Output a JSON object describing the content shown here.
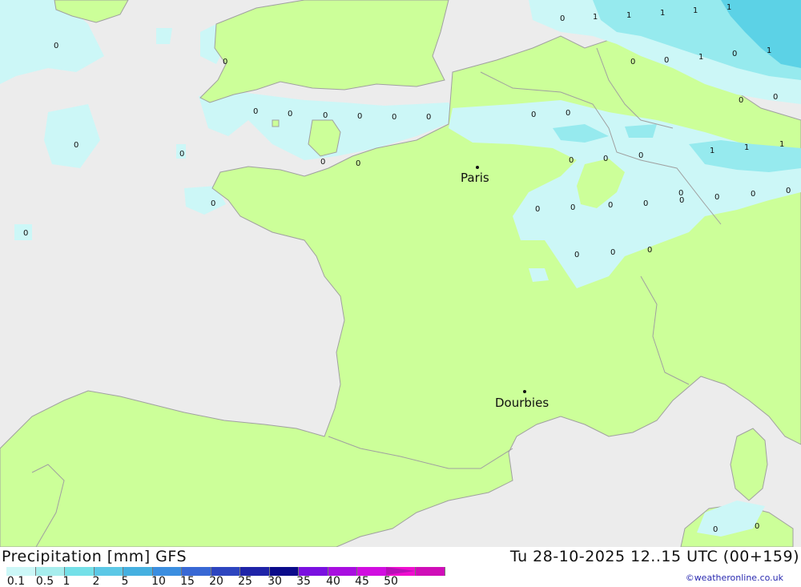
{
  "map": {
    "cities": [
      {
        "name": "Paris"
      },
      {
        "name": "Dourbies"
      }
    ],
    "contour_labels": [
      "0",
      "1",
      "1",
      "1",
      "1",
      "1",
      "0",
      "0",
      "1",
      "0",
      "1",
      "1",
      "0",
      "0",
      "0",
      "0",
      "0",
      "0",
      "0",
      "0",
      "0",
      "0",
      "0",
      "0",
      "0",
      "0",
      "0",
      "0",
      "0",
      "0",
      "0",
      "1",
      "1",
      "1",
      "0",
      "0",
      "0",
      "0",
      "0",
      "0",
      "0",
      "0",
      "0",
      "0",
      "0",
      "0",
      "0",
      "0",
      "0",
      "0",
      "0"
    ],
    "colors": {
      "sea": "#ececec",
      "land": "#ccff99",
      "precip_light": "#ccf7f7",
      "precip_mid": "#96eaee",
      "precip_heavy": "#5cd2e6",
      "border": "#a0a0a0"
    }
  },
  "footer": {
    "title": "Precipitation [mm] GFS",
    "time": "Tu 28-10-2025 12..15 UTC (00+159)",
    "credit": "©weatheronline.co.uk",
    "colorbar": {
      "colors": [
        "#ccf7f7",
        "#a6eded",
        "#74e0e8",
        "#5cc8e6",
        "#45b0e0",
        "#3b8ee0",
        "#3868d4",
        "#2d45bf",
        "#1f24a8",
        "#0b0b8a",
        "#7a10e0",
        "#a80ee0",
        "#d10ee0",
        "#f00ecf",
        "#d00eb8"
      ],
      "ticks": [
        "0.1",
        "0.5",
        "1",
        "2",
        "5",
        "10",
        "15",
        "20",
        "25",
        "30",
        "35",
        "40",
        "45",
        "50"
      ]
    }
  }
}
